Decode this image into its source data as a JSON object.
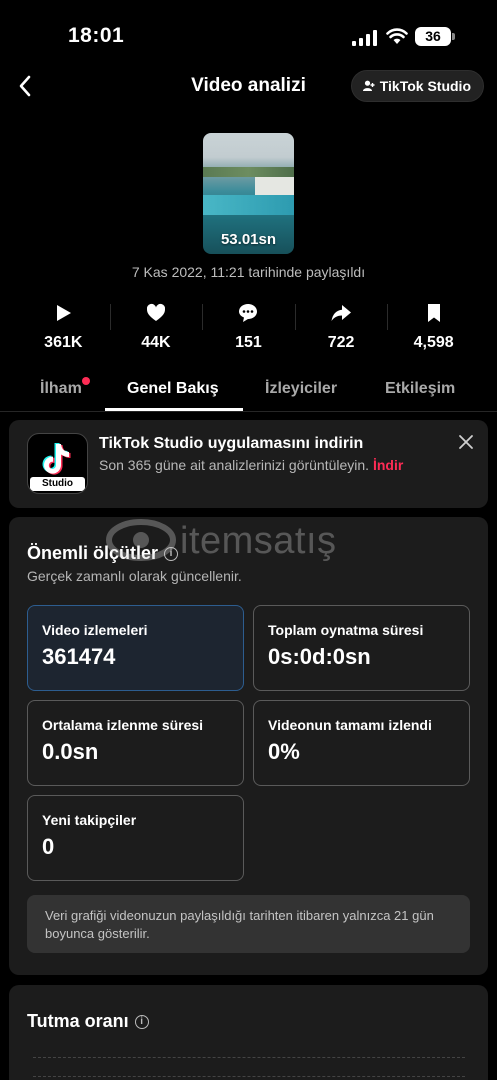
{
  "status_bar": {
    "time": "18:01",
    "battery": "36"
  },
  "header": {
    "title": "Video analizi",
    "studio_button": "TikTok Studio"
  },
  "video": {
    "duration": "53.01sn",
    "posted": "7 Kas 2022, 11:21 tarihinde paylaşıldı"
  },
  "stats": [
    {
      "icon": "play-icon",
      "value": "361K"
    },
    {
      "icon": "heart-icon",
      "value": "44K"
    },
    {
      "icon": "comment-icon",
      "value": "151"
    },
    {
      "icon": "share-icon",
      "value": "722"
    },
    {
      "icon": "bookmark-icon",
      "value": "4,598"
    }
  ],
  "tabs": [
    {
      "label": "İlham",
      "has_dot": true
    },
    {
      "label": "Genel Bakış",
      "active": true
    },
    {
      "label": "İzleyiciler"
    },
    {
      "label": "Etkileşim"
    }
  ],
  "promo": {
    "app_label": "Studio",
    "title": "TikTok Studio uygulamasını indirin",
    "subtitle": "Son 365 güne ait analizlerinizi görüntüleyin.",
    "link": "İndir"
  },
  "watermark": "itemsatış",
  "metrics": {
    "title": "Önemli ölçütler",
    "subtitle": "Gerçek zamanlı olarak güncellenir.",
    "items": [
      {
        "label": "Video izlemeleri",
        "value": "361474",
        "selected": true
      },
      {
        "label": "Toplam oynatma süresi",
        "value": "0s:0d:0sn"
      },
      {
        "label": "Ortalama izlenme süresi",
        "value": "0.0sn"
      },
      {
        "label": "Videonun tamamı izlendi",
        "value": "0%"
      },
      {
        "label": "Yeni takipçiler",
        "value": "0"
      }
    ],
    "note": "Veri grafiği videonuzun paylaşıldığı tarihten itibaren yalnızca 21 gün boyunca gösterilir."
  },
  "retention": {
    "title": "Tutma oranı"
  },
  "colors": {
    "accent": "#fe2c55",
    "background": "#000000",
    "card": "#1c1c1c"
  }
}
